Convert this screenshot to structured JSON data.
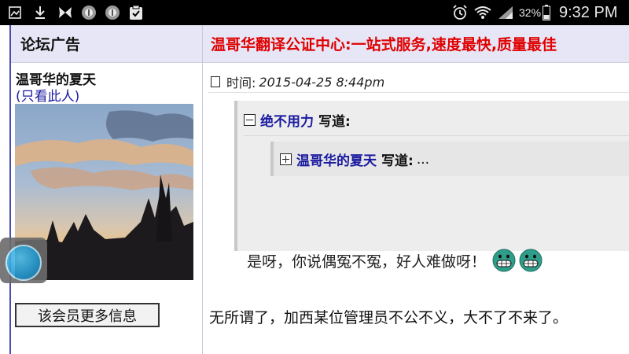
{
  "status_bar": {
    "battery_percent": "32%",
    "time": "9:32 PM",
    "icons": [
      "image-icon",
      "download-icon",
      "butterfly-icon",
      "app-icon",
      "app-icon",
      "clipboard-check-icon",
      "alarm-icon",
      "wifi-icon",
      "signal-icon",
      "battery-icon"
    ]
  },
  "sidebar": {
    "header": "论坛广告",
    "author": "温哥华的夏天",
    "only_this_open": "(",
    "only_this": "只看此人",
    "only_this_close": ")",
    "more_info_button": "该会员更多信息"
  },
  "ad_banner": "温哥华翻译公证中心:一站式服务,速度最快,质量最佳",
  "post": {
    "time_label": "时间:",
    "time_value": "2015-04-25 8:44pm",
    "quote": {
      "author": "绝不用力",
      "wrote": "写道:",
      "nested": {
        "author": "温哥华的夏天",
        "wrote": "写道:",
        "ellipsis": "..."
      },
      "body": "是呀，你说偶冤不冤，好人难做呀！"
    },
    "body": "无所谓了，加西某位管理员不公不义，大不了不来了。"
  },
  "colors": {
    "header_bg": "#e6e6f6",
    "ad_red": "#e00000",
    "link_blue": "#1a1aa0"
  }
}
